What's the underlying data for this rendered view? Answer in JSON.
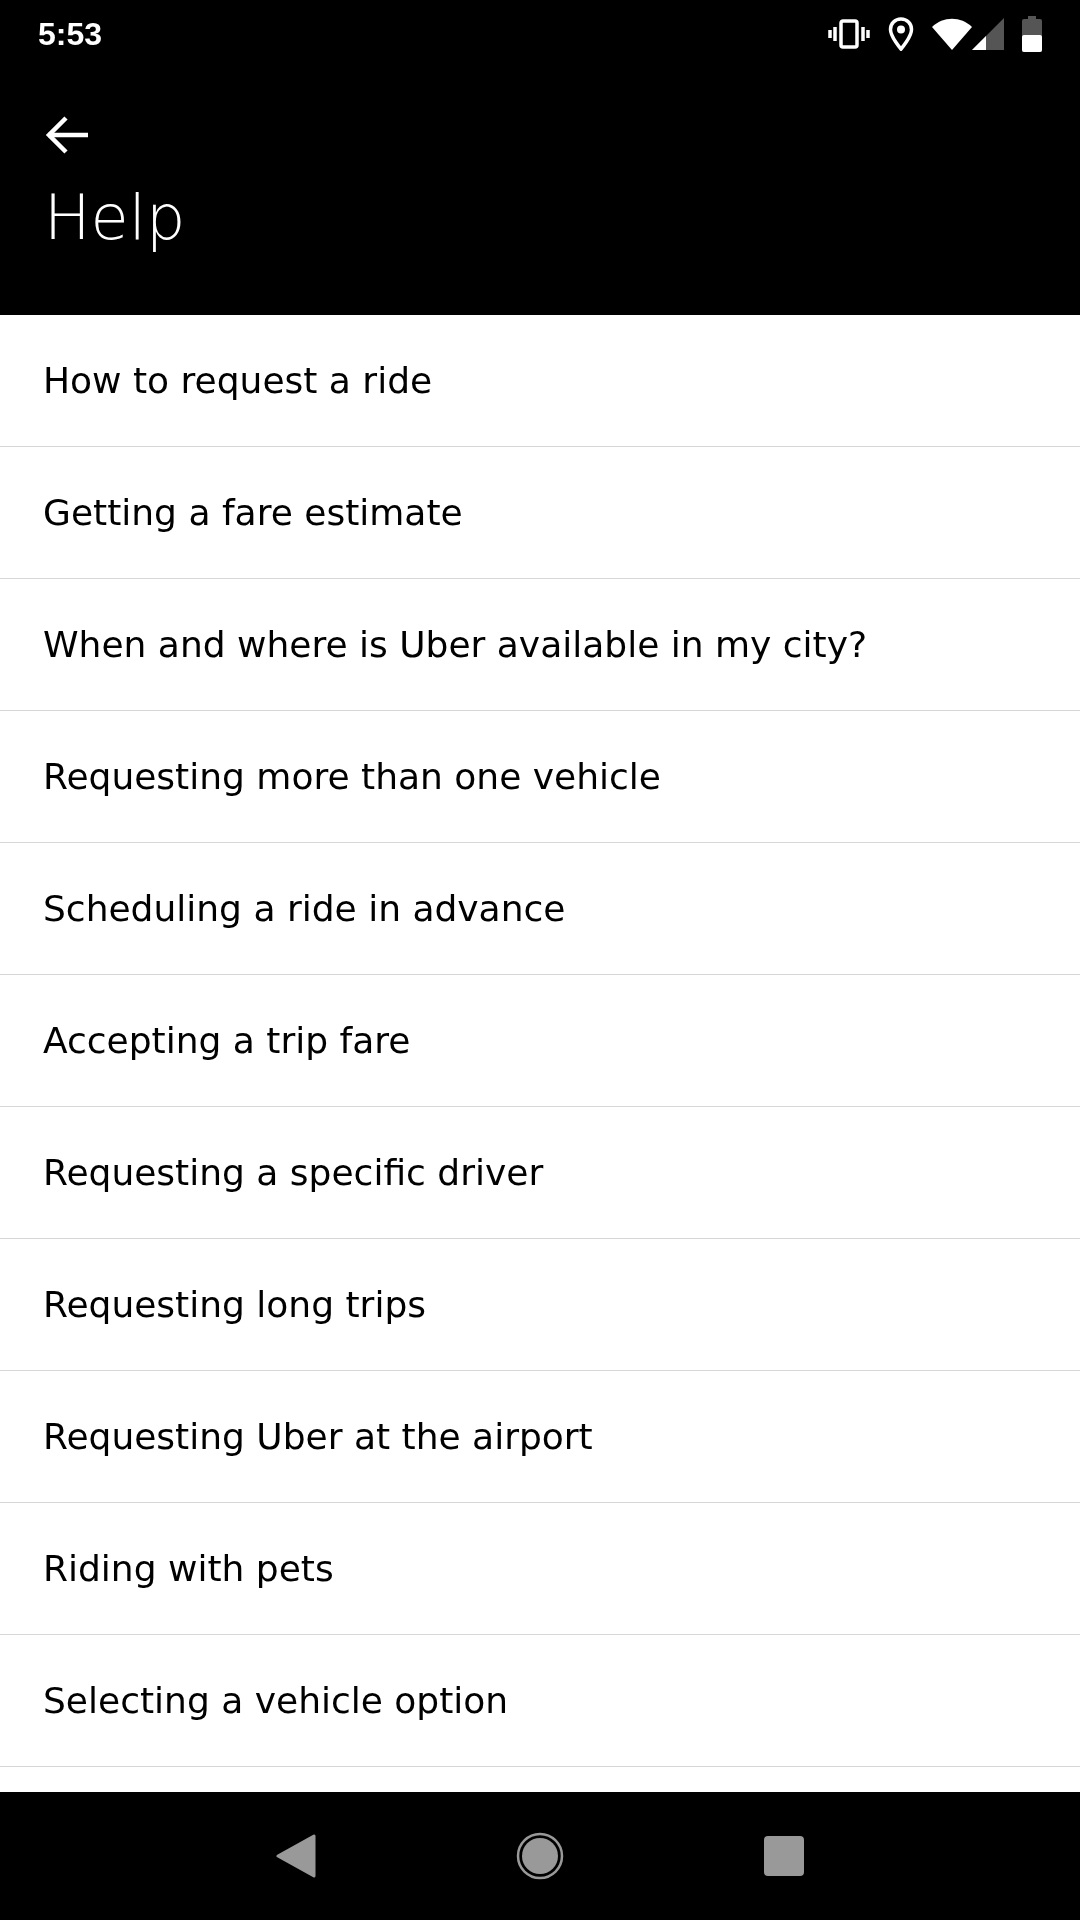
{
  "status_bar": {
    "time": "5:53"
  },
  "app_bar": {
    "title": "Help"
  },
  "topics": [
    {
      "label": "How to request a ride"
    },
    {
      "label": "Getting a fare estimate"
    },
    {
      "label": "When and where is Uber available in my city?"
    },
    {
      "label": "Requesting more than one vehicle"
    },
    {
      "label": "Scheduling a ride in advance"
    },
    {
      "label": "Accepting a trip fare"
    },
    {
      "label": "Requesting a specific driver"
    },
    {
      "label": "Requesting long trips"
    },
    {
      "label": "Requesting Uber at the airport"
    },
    {
      "label": "Riding with pets"
    },
    {
      "label": "Selecting a vehicle option"
    }
  ]
}
